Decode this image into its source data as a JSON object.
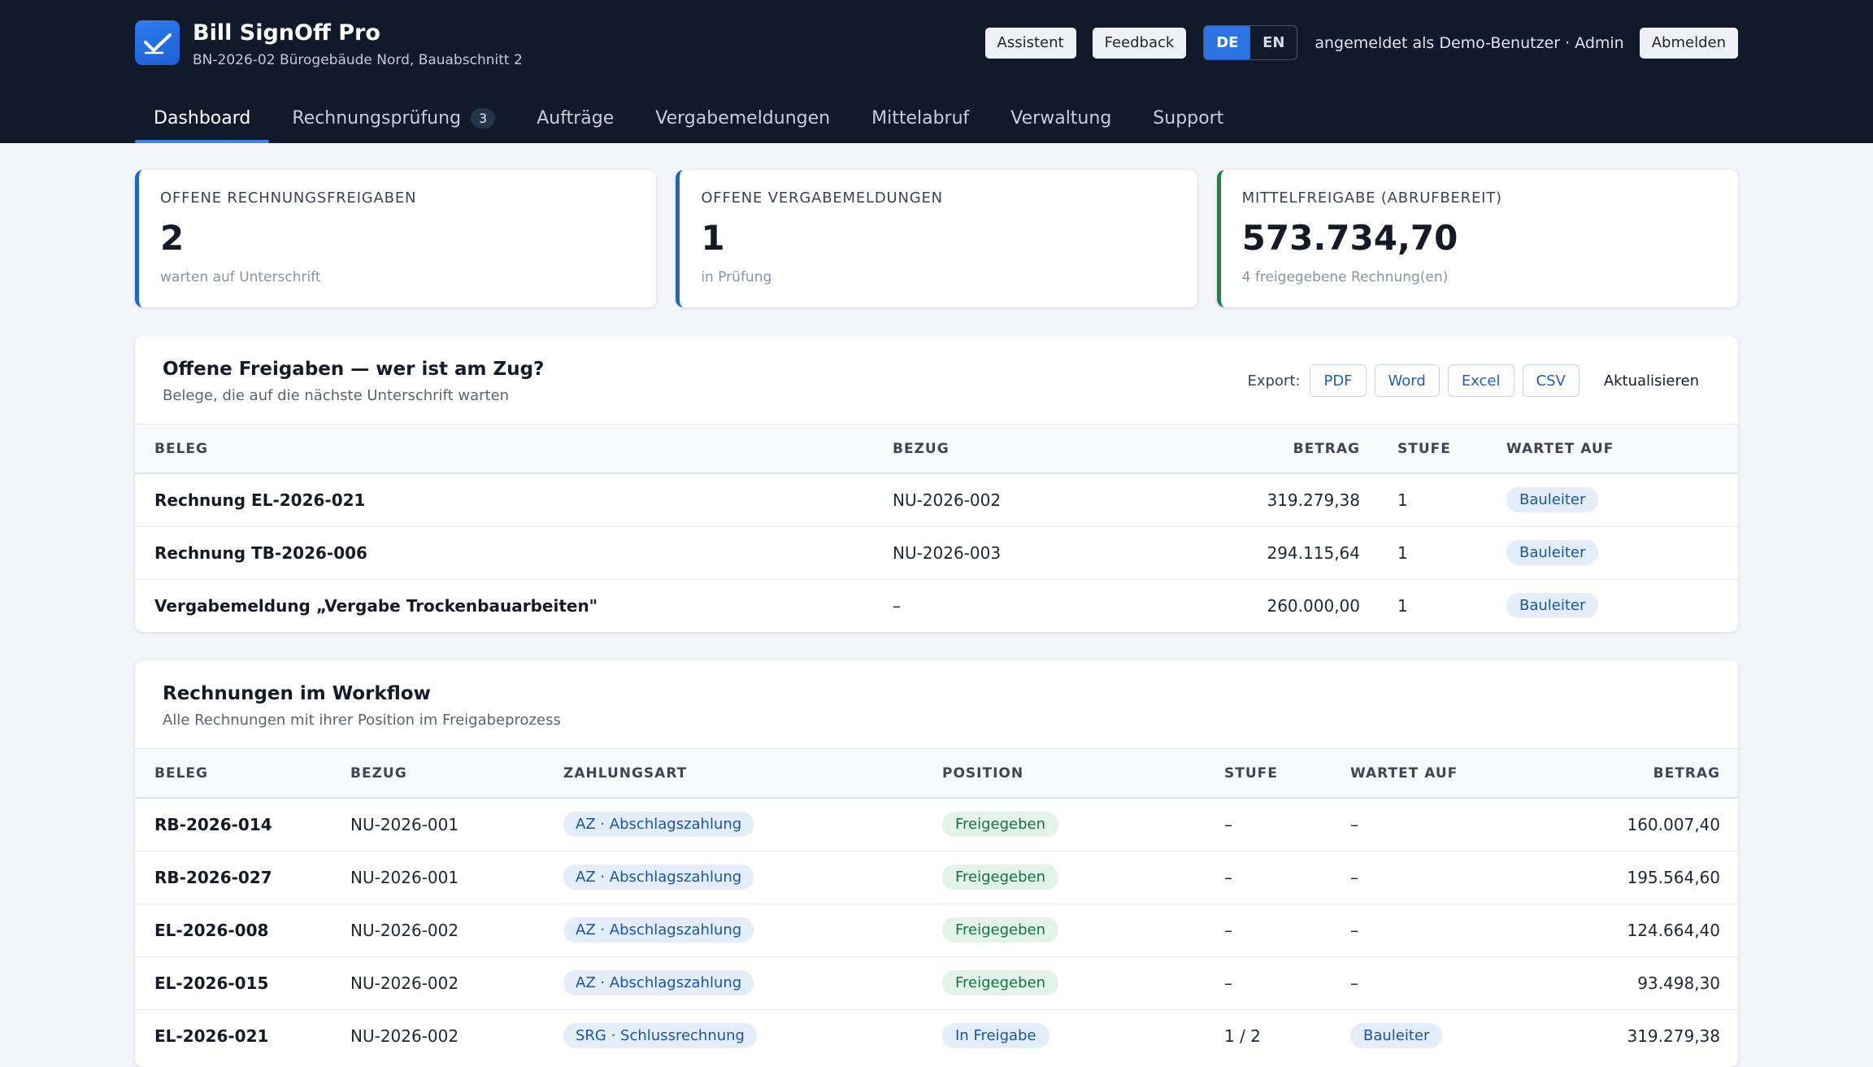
{
  "app": {
    "title": "Bill SignOff Pro",
    "subtitle": "BN-2026-02 Bürogebäude Nord, Bauabschnitt 2"
  },
  "header": {
    "assistant_label": "Assistent",
    "feedback_label": "Feedback",
    "lang_de": "DE",
    "lang_en": "EN",
    "active_lang": "DE",
    "user_info": "angemeldet als Demo-Benutzer · Admin",
    "logout_label": "Abmelden"
  },
  "nav": {
    "dashboard": "Dashboard",
    "invoice_review": "Rechnungsprüfung",
    "invoice_review_count": "3",
    "orders": "Aufträge",
    "award_reports": "Vergabemeldungen",
    "fund_request": "Mittelabruf",
    "admin": "Verwaltung",
    "support": "Support"
  },
  "stats": [
    {
      "label": "Offene Rechnungsfreigaben",
      "value": "2",
      "note": "warten auf Unterschrift",
      "accent": "#1e66c9"
    },
    {
      "label": "Offene Vergabemeldungen",
      "value": "1",
      "note": "in Prüfung",
      "accent": "#1e66c9"
    },
    {
      "label": "Mittelfreigabe (abrufbereit)",
      "value": "573.734,70",
      "note": "4 freigegebene Rechnung(en)",
      "accent": "#19844a"
    }
  ],
  "pending": {
    "title": "Offene Freigaben — wer ist am Zug?",
    "subtitle": "Belege, die auf die nächste Unterschrift warten",
    "export_label": "Export:",
    "export_pdf": "PDF",
    "export_word": "Word",
    "export_excel": "Excel",
    "export_csv": "CSV",
    "refresh_label": "Aktualisieren",
    "columns": {
      "doc": "Beleg",
      "ref": "Bezug",
      "amount": "Betrag",
      "stage": "Stufe",
      "waiting": "Wartet auf"
    },
    "rows": [
      {
        "doc": "Rechnung EL-2026-021",
        "ref": "NU-2026-002",
        "amount": "319.279,38",
        "stage": "1",
        "waiting": "Bauleiter"
      },
      {
        "doc": "Rechnung TB-2026-006",
        "ref": "NU-2026-003",
        "amount": "294.115,64",
        "stage": "1",
        "waiting": "Bauleiter"
      },
      {
        "doc": "Vergabemeldung „Vergabe Trockenbauarbeiten\"",
        "ref": "–",
        "amount": "260.000,00",
        "stage": "1",
        "waiting": "Bauleiter"
      }
    ]
  },
  "workflow": {
    "title": "Rechnungen im Workflow",
    "subtitle": "Alle Rechnungen mit ihrer Position im Freigabeprozess",
    "columns": {
      "doc": "Beleg",
      "ref": "Bezug",
      "payment": "Zahlungsart",
      "position": "Position",
      "stage": "Stufe",
      "waiting": "Wartet auf",
      "amount": "Betrag"
    },
    "rows": [
      {
        "doc": "RB-2026-014",
        "ref": "NU-2026-001",
        "payment": "AZ · Abschlagszahlung",
        "position": "Freigegeben",
        "stage": "–",
        "waiting": "–",
        "amount": "160.007,40"
      },
      {
        "doc": "RB-2026-027",
        "ref": "NU-2026-001",
        "payment": "AZ · Abschlagszahlung",
        "position": "Freigegeben",
        "stage": "–",
        "waiting": "–",
        "amount": "195.564,60"
      },
      {
        "doc": "EL-2026-008",
        "ref": "NU-2026-002",
        "payment": "AZ · Abschlagszahlung",
        "position": "Freigegeben",
        "stage": "–",
        "waiting": "–",
        "amount": "124.664,40"
      },
      {
        "doc": "EL-2026-015",
        "ref": "NU-2026-002",
        "payment": "AZ · Abschlagszahlung",
        "position": "Freigegeben",
        "stage": "–",
        "waiting": "–",
        "amount": "93.498,30"
      },
      {
        "doc": "EL-2026-021",
        "ref": "NU-2026-002",
        "payment": "SRG · Schlussrechnung",
        "position": "In Freigabe",
        "stage": "1 / 2",
        "waiting": "Bauleiter",
        "amount": "319.279,38"
      }
    ]
  }
}
